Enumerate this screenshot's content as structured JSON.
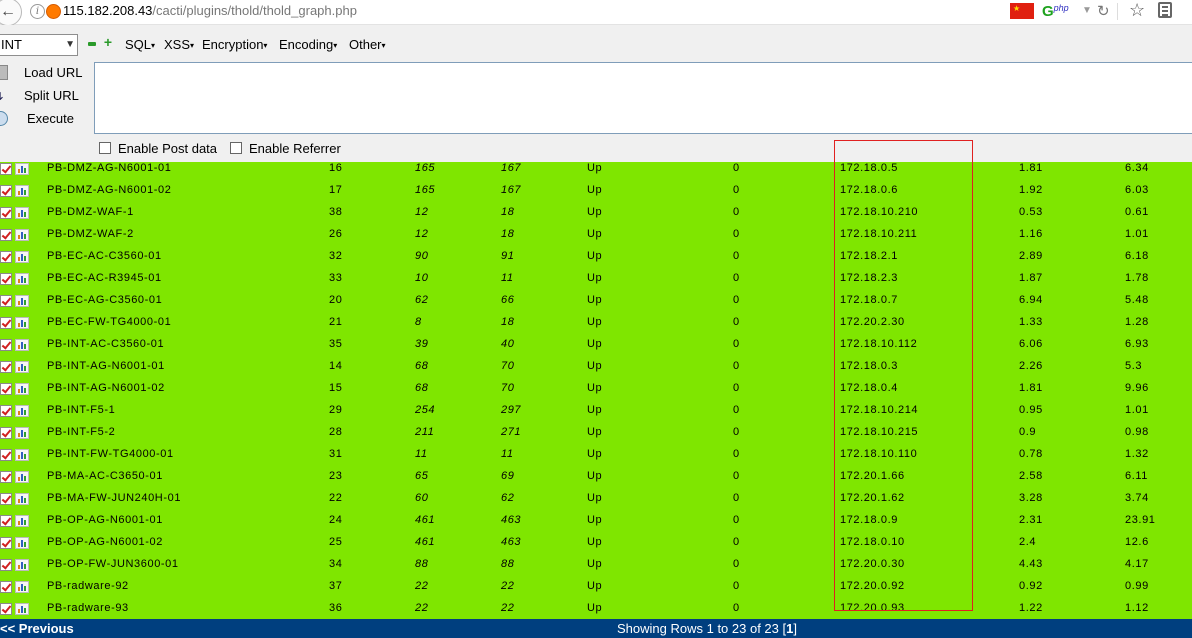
{
  "browser": {
    "url_host": "115.182.208.43",
    "url_path": "/cacti/plugins/thold/thold_graph.php",
    "ext_label": "php"
  },
  "hackbar": {
    "select_value": "INT",
    "menus": [
      "SQL",
      "XSS",
      "Encryption",
      "Encoding",
      "Other"
    ],
    "load_url": "Load URL",
    "split_url": "Split URL",
    "execute": "Execute",
    "enable_post": "Enable Post data",
    "enable_referrer": "Enable Referrer",
    "textarea_value": ""
  },
  "rows": [
    {
      "name": "PB-DMZ-AG-N6001-01",
      "id": "16",
      "a": "165",
      "b": "167",
      "status": "Up",
      "z": "0",
      "ip": "172.18.0.5",
      "v1": "1.81",
      "v2": "6.34"
    },
    {
      "name": "PB-DMZ-AG-N6001-02",
      "id": "17",
      "a": "165",
      "b": "167",
      "status": "Up",
      "z": "0",
      "ip": "172.18.0.6",
      "v1": "1.92",
      "v2": "6.03"
    },
    {
      "name": "PB-DMZ-WAF-1",
      "id": "38",
      "a": "12",
      "b": "18",
      "status": "Up",
      "z": "0",
      "ip": "172.18.10.210",
      "v1": "0.53",
      "v2": "0.61"
    },
    {
      "name": "PB-DMZ-WAF-2",
      "id": "26",
      "a": "12",
      "b": "18",
      "status": "Up",
      "z": "0",
      "ip": "172.18.10.211",
      "v1": "1.16",
      "v2": "1.01"
    },
    {
      "name": "PB-EC-AC-C3560-01",
      "id": "32",
      "a": "90",
      "b": "91",
      "status": "Up",
      "z": "0",
      "ip": "172.18.2.1",
      "v1": "2.89",
      "v2": "6.18"
    },
    {
      "name": "PB-EC-AC-R3945-01",
      "id": "33",
      "a": "10",
      "b": "11",
      "status": "Up",
      "z": "0",
      "ip": "172.18.2.3",
      "v1": "1.87",
      "v2": "1.78"
    },
    {
      "name": "PB-EC-AG-C3560-01",
      "id": "20",
      "a": "62",
      "b": "66",
      "status": "Up",
      "z": "0",
      "ip": "172.18.0.7",
      "v1": "6.94",
      "v2": "5.48"
    },
    {
      "name": "PB-EC-FW-TG4000-01",
      "id": "21",
      "a": "8",
      "b": "18",
      "status": "Up",
      "z": "0",
      "ip": "172.20.2.30",
      "v1": "1.33",
      "v2": "1.28"
    },
    {
      "name": "PB-INT-AC-C3560-01",
      "id": "35",
      "a": "39",
      "b": "40",
      "status": "Up",
      "z": "0",
      "ip": "172.18.10.112",
      "v1": "6.06",
      "v2": "6.93"
    },
    {
      "name": "PB-INT-AG-N6001-01",
      "id": "14",
      "a": "68",
      "b": "70",
      "status": "Up",
      "z": "0",
      "ip": "172.18.0.3",
      "v1": "2.26",
      "v2": "5.3"
    },
    {
      "name": "PB-INT-AG-N6001-02",
      "id": "15",
      "a": "68",
      "b": "70",
      "status": "Up",
      "z": "0",
      "ip": "172.18.0.4",
      "v1": "1.81",
      "v2": "9.96"
    },
    {
      "name": "PB-INT-F5-1",
      "id": "29",
      "a": "254",
      "b": "297",
      "status": "Up",
      "z": "0",
      "ip": "172.18.10.214",
      "v1": "0.95",
      "v2": "1.01"
    },
    {
      "name": "PB-INT-F5-2",
      "id": "28",
      "a": "211",
      "b": "271",
      "status": "Up",
      "z": "0",
      "ip": "172.18.10.215",
      "v1": "0.9",
      "v2": "0.98"
    },
    {
      "name": "PB-INT-FW-TG4000-01",
      "id": "31",
      "a": "11",
      "b": "11",
      "status": "Up",
      "z": "0",
      "ip": "172.18.10.110",
      "v1": "0.78",
      "v2": "1.32"
    },
    {
      "name": "PB-MA-AC-C3650-01",
      "id": "23",
      "a": "65",
      "b": "69",
      "status": "Up",
      "z": "0",
      "ip": "172.20.1.66",
      "v1": "2.58",
      "v2": "6.11"
    },
    {
      "name": "PB-MA-FW-JUN240H-01",
      "id": "22",
      "a": "60",
      "b": "62",
      "status": "Up",
      "z": "0",
      "ip": "172.20.1.62",
      "v1": "3.28",
      "v2": "3.74"
    },
    {
      "name": "PB-OP-AG-N6001-01",
      "id": "24",
      "a": "461",
      "b": "463",
      "status": "Up",
      "z": "0",
      "ip": "172.18.0.9",
      "v1": "2.31",
      "v2": "23.91"
    },
    {
      "name": "PB-OP-AG-N6001-02",
      "id": "25",
      "a": "461",
      "b": "463",
      "status": "Up",
      "z": "0",
      "ip": "172.18.0.10",
      "v1": "2.4",
      "v2": "12.6"
    },
    {
      "name": "PB-OP-FW-JUN3600-01",
      "id": "34",
      "a": "88",
      "b": "88",
      "status": "Up",
      "z": "0",
      "ip": "172.20.0.30",
      "v1": "4.43",
      "v2": "4.17"
    },
    {
      "name": "PB-radware-92",
      "id": "37",
      "a": "22",
      "b": "22",
      "status": "Up",
      "z": "0",
      "ip": "172.20.0.92",
      "v1": "0.92",
      "v2": "0.99"
    },
    {
      "name": "PB-radware-93",
      "id": "36",
      "a": "22",
      "b": "22",
      "status": "Up",
      "z": "0",
      "ip": "172.20.0.93",
      "v1": "1.22",
      "v2": "1.12"
    }
  ],
  "footer": {
    "previous": "<< Previous",
    "showing_prefix": "Showing Rows 1 to 23 of 23 [",
    "page": "1",
    "showing_suffix": "]"
  },
  "colors": {
    "row_bg": "#7fe600",
    "footer_bg": "#003f7f",
    "highlight_box": "#e02020"
  }
}
